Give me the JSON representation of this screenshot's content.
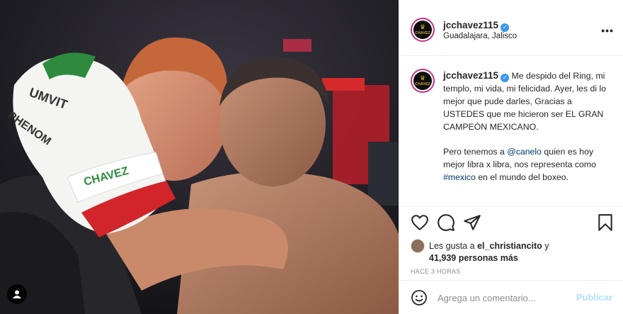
{
  "post": {
    "username": "jcchavez115",
    "location": "Guadalajara, Jalisco",
    "avatar_crown": "♛",
    "avatar_monogram": "CHAVEZ",
    "verified_mark": "✓",
    "more_label": "•••"
  },
  "caption": {
    "username": "jcchavez115",
    "paragraph1": "Me despido del Ring, mi templo, mi vida, mi felicidad. Ayer, les di lo mejor que pude darles, Gracias a USTEDES que me hicieron ser EL GRAN CAMPEÓN MEXICANO.",
    "p2_before": "Pero tenemos a ",
    "p2_mention": "@canelo",
    "p2_middle": " quien es hoy mejor libra x libra, nos representa como ",
    "p2_hashtag": "#mexico",
    "p2_after": " en el mundo del boxeo."
  },
  "likes": {
    "prefix": "Les gusta a ",
    "user": "el_christiancito",
    "conjunction": " y",
    "count": "41,939 personas más"
  },
  "timestamp": "HACE 3 HORAS",
  "comment": {
    "placeholder": "Agrega un comentario...",
    "post_label": "Publicar"
  },
  "photo": {
    "glove_text_1": "UMVIT",
    "glove_text_2": "PHENOM",
    "glove_text_3": "CHAVEZ"
  },
  "colors": {
    "accent_blue": "#3897f0",
    "link_blue": "#00376b",
    "post_disabled": "#b2dffc",
    "meta_gray": "#8e8e8e"
  }
}
